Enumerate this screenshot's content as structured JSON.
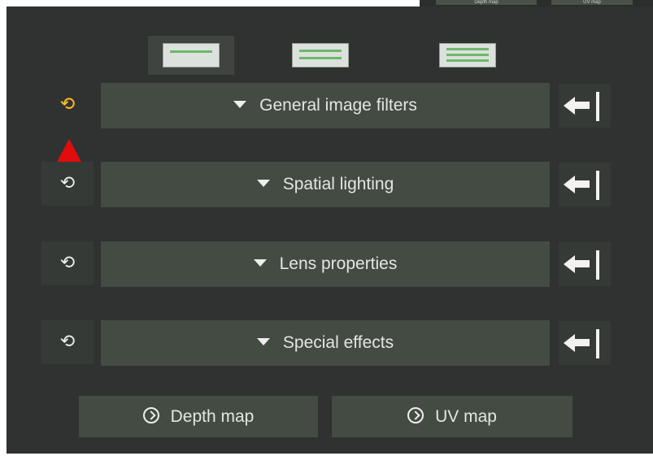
{
  "top_toolbar": {
    "depth_map_label": "Depth map",
    "uv_map_label": "UV map"
  },
  "view_modes": [
    {
      "name": "single-line",
      "active": true
    },
    {
      "name": "double-line",
      "active": false
    },
    {
      "name": "multi-line",
      "active": false
    }
  ],
  "sections": [
    {
      "label": "General image filters",
      "reset_icon": "cycle-icon-highlighted",
      "dock_icon": "dock-left-icon"
    },
    {
      "label": "Spatial lighting",
      "reset_icon": "cycle-icon",
      "dock_icon": "dock-left-icon"
    },
    {
      "label": "Lens properties",
      "reset_icon": "cycle-icon",
      "dock_icon": "dock-left-icon"
    },
    {
      "label": "Special effects",
      "reset_icon": "cycle-icon",
      "dock_icon": "dock-left-icon"
    }
  ],
  "bottom_buttons": {
    "depth_map": "Depth map",
    "uv_map": "UV map"
  },
  "colors": {
    "panel_background": "#2f3230",
    "button_background": "#444b43",
    "highlight_icon": "#f1c232",
    "marker": "#e20c0c"
  }
}
